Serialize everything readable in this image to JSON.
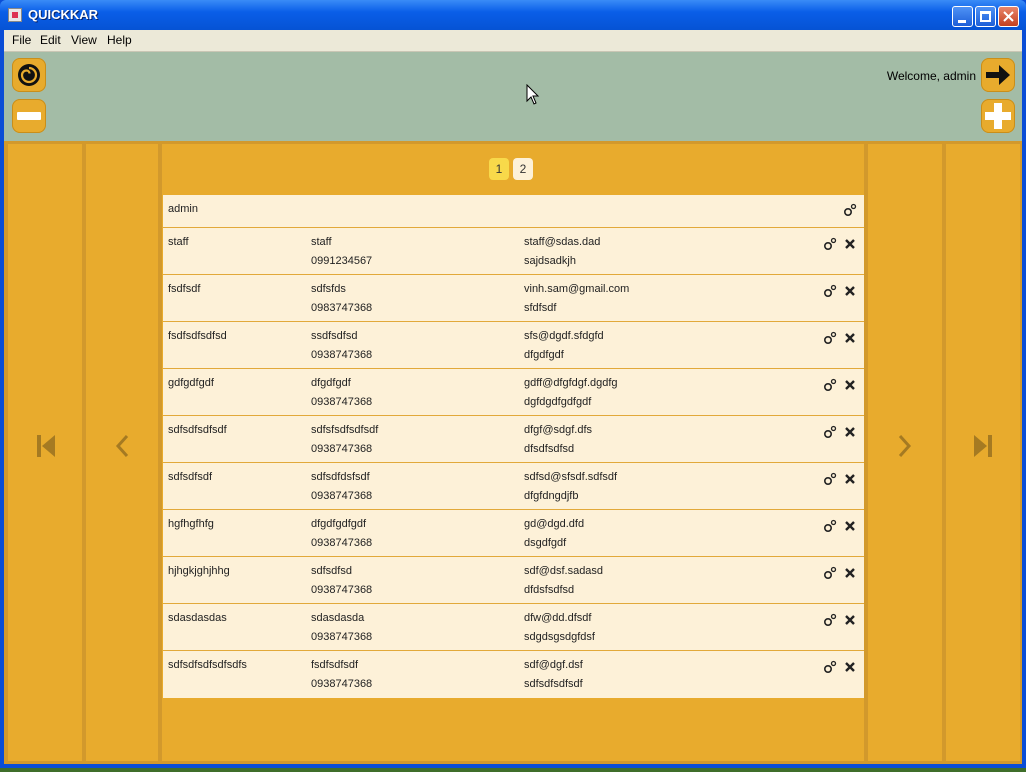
{
  "window": {
    "title": "QUICKKAR"
  },
  "menu": [
    "File",
    "Edit",
    "View",
    "Help"
  ],
  "header": {
    "welcome": "Welcome, admin"
  },
  "pagination": {
    "pages": [
      "1",
      "2"
    ],
    "current": "1"
  },
  "users": [
    {
      "username": "admin",
      "name": "",
      "phone": "",
      "email": "",
      "address": "",
      "deletable": false
    },
    {
      "username": "staff",
      "name": "staff",
      "phone": "0991234567",
      "email": "staff@sdas.dad",
      "address": "sajdsadkjh",
      "deletable": true
    },
    {
      "username": "fsdfsdf",
      "name": "sdfsfds",
      "phone": "0983747368",
      "email": "vinh.sam@gmail.com",
      "address": "sfdfsdf",
      "deletable": true
    },
    {
      "username": "fsdfsdfsdfsd",
      "name": "ssdfsdfsd",
      "phone": "0938747368",
      "email": "sfs@dgdf.sfdgfd",
      "address": "dfgdfgdf",
      "deletable": true
    },
    {
      "username": "gdfgdfgdf",
      "name": "dfgdfgdf",
      "phone": "0938747368",
      "email": "gdff@dfgfdgf.dgdfg",
      "address": "dgfdgdfgdfgdf",
      "deletable": true
    },
    {
      "username": "sdfsdfsdfsdf",
      "name": "sdfsfsdfsdfsdf",
      "phone": "0938747368",
      "email": "dfgf@sdgf.dfs",
      "address": "dfsdfsdfsd",
      "deletable": true
    },
    {
      "username": "sdfsdfsdf",
      "name": "sdfsdfdsfsdf",
      "phone": "0938747368",
      "email": "sdfsd@sfsdf.sdfsdf",
      "address": "dfgfdngdjfb",
      "deletable": true
    },
    {
      "username": "hgfhgfhfg",
      "name": "dfgdfgdfgdf",
      "phone": "0938747368",
      "email": "gd@dgd.dfd",
      "address": "dsgdfgdf",
      "deletable": true
    },
    {
      "username": "hjhgkjghjhhg",
      "name": "sdfsdfsd",
      "phone": "0938747368",
      "email": "sdf@dsf.sadasd",
      "address": "dfdsfsdfsd",
      "deletable": true
    },
    {
      "username": "sdasdasdas",
      "name": "sdasdasda",
      "phone": "0938747368",
      "email": "dfw@dd.dfsdf",
      "address": "sdgdsgsdgfdsf",
      "deletable": true
    },
    {
      "username": "sdfsdfsdfsdfsdfs",
      "name": "fsdfsdfsdf",
      "phone": "0938747368",
      "email": "sdf@dgf.dsf",
      "address": "sdfsdfsdfsdf",
      "deletable": true
    }
  ],
  "colors": {
    "header": "#a3bca6",
    "panel": "#e8ab2d",
    "row": "#fdf1d8",
    "divider": "#e2a93a",
    "page_active": "#f8d94a",
    "page_inactive": "#fdf1d8"
  },
  "icons": {
    "logo": "swirl-logo-icon",
    "minus": "minus-icon",
    "logout": "arrow-right-icon",
    "add": "plus-icon",
    "first": "skip-first-icon",
    "prev": "chevron-left-icon",
    "next": "chevron-right-icon",
    "last": "skip-last-icon",
    "edit": "gear-icon",
    "delete": "close-icon"
  }
}
